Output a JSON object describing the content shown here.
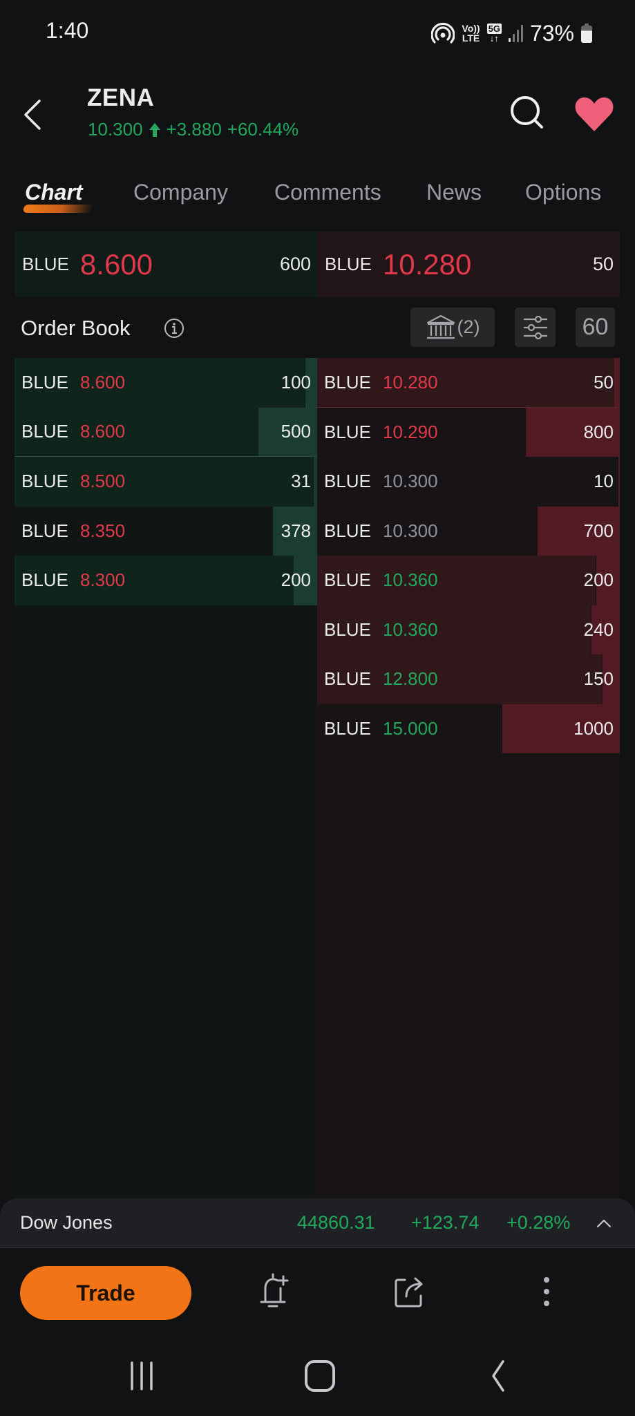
{
  "status_bar": {
    "time": "1:40",
    "volte_top": "Vo))",
    "volte_bottom": "LTE",
    "network": "5G",
    "network_arrows": "↓↑",
    "battery": "73%",
    "icons": [
      "hotspot-icon",
      "volte-icon",
      "5g-data-icon",
      "signal-icon",
      "battery-icon"
    ]
  },
  "header": {
    "ticker": "ZENA",
    "last_price": "10.300",
    "change": "+3.880",
    "change_pct": "+60.44%",
    "direction": "up",
    "icons": [
      "back-icon",
      "search-icon",
      "heart-icon"
    ]
  },
  "tabs": [
    {
      "label": "Chart",
      "active": true
    },
    {
      "label": "Company",
      "active": false
    },
    {
      "label": "Comments",
      "active": false
    },
    {
      "label": "News",
      "active": false
    },
    {
      "label": "Options",
      "active": false
    }
  ],
  "best_bid": {
    "broker": "BLUE",
    "price": "8.600",
    "qty": "600"
  },
  "best_ask": {
    "broker": "BLUE",
    "price": "10.280",
    "qty": "50"
  },
  "order_book": {
    "title": "Order Book",
    "brokers_count": "(2)",
    "depth_level": "60",
    "max_qty": 1000,
    "bids": [
      {
        "broker": "BLUE",
        "price": "8.600",
        "qty": "100",
        "price_color": "red",
        "cum_fill": 0.96
      },
      {
        "broker": "BLUE",
        "price": "8.600",
        "qty": "500",
        "price_color": "red",
        "cum_fill": 0.96
      },
      {
        "broker": "BLUE",
        "price": "8.500",
        "qty": "31",
        "price_color": "red",
        "cum_fill": 0.986
      },
      {
        "broker": "BLUE",
        "price": "8.350",
        "qty": "378",
        "price_color": "red",
        "cum_fill": 0
      },
      {
        "broker": "BLUE",
        "price": "8.300",
        "qty": "200",
        "price_color": "red",
        "cum_fill": 0.922
      }
    ],
    "asks": [
      {
        "broker": "BLUE",
        "price": "10.280",
        "qty": "50",
        "price_color": "red",
        "cum_fill": 1.0
      },
      {
        "broker": "BLUE",
        "price": "10.290",
        "qty": "800",
        "price_color": "red",
        "cum_fill": 0
      },
      {
        "broker": "BLUE",
        "price": "10.300",
        "qty": "10",
        "price_color": "gray",
        "cum_fill": 0
      },
      {
        "broker": "BLUE",
        "price": "10.300",
        "qty": "700",
        "price_color": "gray",
        "cum_fill": 0
      },
      {
        "broker": "BLUE",
        "price": "10.360",
        "qty": "200",
        "price_color": "green",
        "cum_fill": 0.92
      },
      {
        "broker": "BLUE",
        "price": "10.360",
        "qty": "240",
        "price_color": "green",
        "cum_fill": 0.905
      },
      {
        "broker": "BLUE",
        "price": "12.800",
        "qty": "150",
        "price_color": "green",
        "cum_fill": 0.94
      },
      {
        "broker": "BLUE",
        "price": "15.000",
        "qty": "1000",
        "price_color": "green",
        "cum_fill": 0
      }
    ]
  },
  "index_ticker": {
    "name": "Dow Jones",
    "value": "44860.31",
    "change": "+123.74",
    "change_pct": "+0.28%"
  },
  "action_bar": {
    "trade_label": "Trade",
    "icons": [
      "add-alert-icon",
      "share-icon",
      "more-icon"
    ]
  },
  "colors": {
    "accent": "#f27417",
    "up": "#22a75d",
    "down": "#e0394b",
    "neutral": "#8d92a0",
    "favorite": "#f0607a"
  }
}
